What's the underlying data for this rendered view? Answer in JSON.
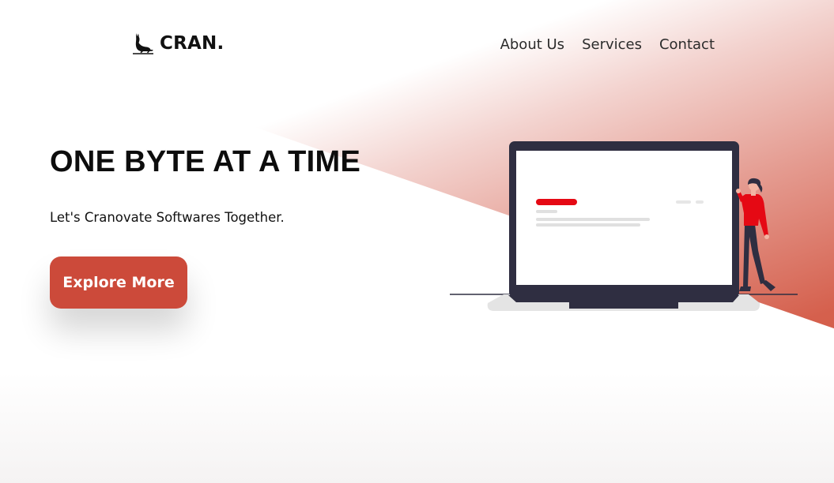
{
  "brand": {
    "name": "CRAN.",
    "logo_icon": "cat-icon",
    "accent_color": "#cc4a3a"
  },
  "nav": {
    "items": [
      {
        "label": "About Us"
      },
      {
        "label": "Services"
      },
      {
        "label": "Contact"
      }
    ]
  },
  "hero": {
    "title": "ONE BYTE AT A TIME",
    "subtitle": "Let's Cranovate Softwares Together.",
    "cta_label": "Explore More",
    "illustration": "laptop-presenter-illustration"
  }
}
